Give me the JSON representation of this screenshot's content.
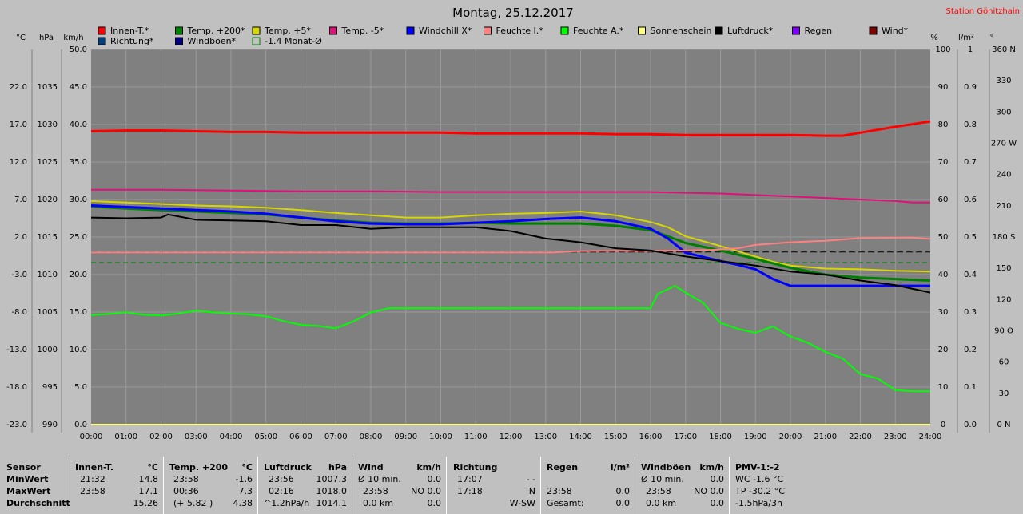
{
  "title": "Montag, 25.12.2017",
  "station": "Station Gönitzhain",
  "axes": {
    "celsius": {
      "unit": "°C",
      "ticks": [
        "22.0",
        "17.0",
        "12.0",
        "7.0",
        "2.0",
        "-3.0",
        "-8.0",
        "-13.0",
        "-18.0",
        "-23.0"
      ]
    },
    "hpa": {
      "unit": "hPa",
      "ticks": [
        "1035",
        "1030",
        "1025",
        "1020",
        "1015",
        "1010",
        "1005",
        "1000",
        "995",
        "990"
      ]
    },
    "kmh": {
      "unit": "km/h",
      "ticks": [
        "50.0",
        "45.0",
        "40.0",
        "35.0",
        "30.0",
        "25.0",
        "20.0",
        "15.0",
        "10.0",
        "5.0",
        "0.0"
      ]
    },
    "percent": {
      "unit": "%",
      "ticks": [
        "100",
        "90",
        "80",
        "70",
        "60",
        "50",
        "40",
        "30",
        "20",
        "10",
        "0"
      ]
    },
    "rain": {
      "unit": "l/m²",
      "ticks": [
        "1",
        "0.9",
        "0.8",
        "0.7",
        "0.6",
        "0.5",
        "0.4",
        "0.3",
        "0.2",
        "0.1",
        "0.0"
      ]
    },
    "deg": {
      "unit": "°",
      "ticks": [
        "360 N",
        "330",
        "300",
        "270 W",
        "240",
        "210",
        "180 S",
        "150",
        "120",
        "90 O",
        "60",
        "30",
        "0 N"
      ]
    },
    "time": [
      "00:00",
      "01:00",
      "02:00",
      "03:00",
      "04:00",
      "05:00",
      "06:00",
      "07:00",
      "08:00",
      "09:00",
      "10:00",
      "11:00",
      "12:00",
      "13:00",
      "14:00",
      "15:00",
      "16:00",
      "17:00",
      "18:00",
      "19:00",
      "20:00",
      "21:00",
      "22:00",
      "23:00",
      "24:00"
    ]
  },
  "legend": [
    {
      "label": "Innen-T.*",
      "color": "#ff0000"
    },
    {
      "label": "Temp. +200*",
      "color": "#008000"
    },
    {
      "label": "Temp. +5*",
      "color": "#d6d600"
    },
    {
      "label": "Temp. -5*",
      "color": "#e0107a"
    },
    {
      "label": "Windchill X*",
      "color": "#0000ff"
    },
    {
      "label": "Feuchte I.*",
      "color": "#ff8080"
    },
    {
      "label": "Feuchte A.*",
      "color": "#00ff00"
    },
    {
      "label": "Sonnenschein",
      "color": "#ffff80"
    },
    {
      "label": "Luftdruck*",
      "color": "#000000"
    },
    {
      "label": "Regen",
      "color": "#8000ff"
    },
    {
      "label": "Wind*",
      "color": "#800000"
    },
    {
      "label": "Richtung*",
      "color": "#004080"
    },
    {
      "label": "Windböen*",
      "color": "#000080"
    },
    {
      "label": "-1.4 Monat-Ø",
      "color": "#008000",
      "text_color": "#008000",
      "hollow": true
    }
  ],
  "chart_data": {
    "type": "line",
    "x_unit": "hour",
    "xlim": [
      0,
      24
    ],
    "ylabel": "°C",
    "ylim": [
      -23,
      27
    ],
    "series": [
      {
        "name": "Innen-T.*",
        "axis": "°C",
        "color": "#ff0000",
        "width": 3,
        "x": [
          0,
          1,
          2,
          3,
          4,
          5,
          6,
          7,
          8,
          9,
          10,
          11,
          12,
          13,
          14,
          15,
          16,
          17,
          18,
          19,
          20,
          21,
          21.5,
          22,
          23,
          24
        ],
        "y": [
          16.1,
          16.2,
          16.2,
          16.1,
          16.0,
          16.0,
          15.9,
          15.9,
          15.9,
          15.9,
          15.9,
          15.8,
          15.8,
          15.8,
          15.8,
          15.7,
          15.7,
          15.6,
          15.6,
          15.6,
          15.6,
          15.5,
          15.5,
          15.9,
          16.7,
          17.4
        ]
      },
      {
        "name": "Temp. -5*",
        "axis": "°C",
        "color": "#e0107a",
        "width": 2,
        "x": [
          0,
          2,
          4,
          6,
          8,
          10,
          12,
          14,
          16,
          18,
          19,
          20,
          21,
          22,
          23,
          23.5,
          24
        ],
        "y": [
          8.3,
          8.3,
          8.2,
          8.1,
          8.1,
          8.0,
          8.0,
          8.0,
          8.0,
          7.8,
          7.6,
          7.4,
          7.2,
          7.0,
          6.8,
          6.6,
          6.6
        ]
      },
      {
        "name": "Temp. +5*",
        "axis": "°C",
        "color": "#d6d600",
        "width": 2,
        "x": [
          0,
          1,
          2,
          3,
          4,
          5,
          6,
          7,
          8,
          9,
          10,
          11,
          12,
          13,
          14,
          15,
          16,
          16.5,
          17,
          18,
          19,
          19.5,
          20,
          21,
          22,
          23,
          24
        ],
        "y": [
          6.8,
          6.6,
          6.4,
          6.2,
          6.1,
          5.9,
          5.6,
          5.2,
          4.9,
          4.6,
          4.6,
          4.9,
          5.1,
          5.2,
          5.4,
          4.9,
          4.0,
          3.3,
          2.1,
          0.8,
          -0.6,
          -1.3,
          -1.8,
          -2.2,
          -2.3,
          -2.5,
          -2.6
        ]
      },
      {
        "name": "Temp. +200*",
        "axis": "°C",
        "color": "#008000",
        "width": 3,
        "x": [
          0,
          1,
          2,
          3,
          4,
          5,
          6,
          7,
          8,
          9,
          10,
          11,
          12,
          13,
          14,
          15,
          16,
          16.5,
          17,
          18,
          19,
          20,
          21,
          22,
          23,
          24
        ],
        "y": [
          6.1,
          5.8,
          5.6,
          5.4,
          5.2,
          5.0,
          4.6,
          4.2,
          3.9,
          3.8,
          3.8,
          3.9,
          3.8,
          3.8,
          3.8,
          3.5,
          2.9,
          2.1,
          1.2,
          0.2,
          -0.9,
          -2.1,
          -3.0,
          -3.4,
          -3.6,
          -3.8
        ]
      },
      {
        "name": "Windchill X*",
        "axis": "°C",
        "color": "#0000ff",
        "width": 3,
        "x": [
          0,
          1,
          2,
          3,
          4,
          5,
          6,
          7,
          8,
          9,
          10,
          11,
          12,
          13,
          14,
          15,
          16,
          16.5,
          17,
          18,
          18.5,
          19,
          19.5,
          20,
          21,
          22,
          23,
          24
        ],
        "y": [
          6.2,
          6.0,
          5.8,
          5.6,
          5.4,
          5.1,
          4.6,
          4.1,
          3.8,
          3.7,
          3.7,
          3.9,
          4.1,
          4.4,
          4.6,
          4.1,
          3.1,
          1.8,
          -0.1,
          -1.2,
          -1.7,
          -2.3,
          -3.6,
          -4.5,
          -4.5,
          -4.5,
          -4.5,
          -4.5
        ]
      },
      {
        "name": "Feuchte I.*",
        "axis": "%",
        "color": "#ff8080",
        "width": 2,
        "x": [
          0,
          2,
          4,
          6,
          8,
          10,
          12,
          13.2,
          13.8,
          14.5,
          15,
          16,
          17,
          17.8,
          18.5,
          19,
          20,
          21,
          22,
          23,
          23.5,
          24
        ],
        "y": [
          45.9,
          45.9,
          45.9,
          45.9,
          45.9,
          45.9,
          45.9,
          45.9,
          46.2,
          46.3,
          46.3,
          46.3,
          46.4,
          46.6,
          47.0,
          47.9,
          48.6,
          49.0,
          49.7,
          49.8,
          49.8,
          49.5
        ]
      },
      {
        "name": "Feuchte A.*",
        "axis": "%",
        "color": "#00ff00",
        "width": 2,
        "x": [
          0,
          0.5,
          1,
          1.5,
          2,
          2.5,
          3,
          3.5,
          4,
          4.5,
          5,
          5.5,
          6,
          6.5,
          7,
          7.5,
          8,
          8.5,
          9,
          10,
          11,
          12,
          13,
          14,
          15,
          16,
          16.2,
          16.7,
          17,
          17.5,
          18,
          18.5,
          19,
          19.5,
          20,
          20.5,
          21,
          21.5,
          22,
          22.5,
          23,
          23.5,
          24
        ],
        "y": [
          29.2,
          29.5,
          29.9,
          29.3,
          29.1,
          29.6,
          30.4,
          29.9,
          29.6,
          29.4,
          28.9,
          27.6,
          26.6,
          26.3,
          25.7,
          27.5,
          29.9,
          31.0,
          31.0,
          31.0,
          31.0,
          31.0,
          31.0,
          31.0,
          31.0,
          31.0,
          34.8,
          37.0,
          35.2,
          32.5,
          27.1,
          25.5,
          24.5,
          26.2,
          23.5,
          21.8,
          19.4,
          17.6,
          13.5,
          12.3,
          9.2,
          8.9,
          8.9
        ]
      },
      {
        "name": "Luftdruck*",
        "axis": "hPa",
        "color": "#000000",
        "width": 2,
        "x": [
          0,
          1,
          2,
          2.2,
          3,
          4,
          5,
          6,
          7,
          8,
          9,
          10,
          11,
          12,
          13,
          14,
          15,
          16,
          17,
          18,
          19,
          20,
          21,
          21.5,
          22,
          23,
          24
        ],
        "y": [
          1017.6,
          1017.5,
          1017.6,
          1018.0,
          1017.3,
          1017.2,
          1017.1,
          1016.6,
          1016.6,
          1016.1,
          1016.3,
          1016.3,
          1016.3,
          1015.8,
          1014.8,
          1014.3,
          1013.5,
          1013.2,
          1012.4,
          1011.8,
          1011.2,
          1010.4,
          1010.0,
          1009.6,
          1009.2,
          1008.6,
          1007.6
        ]
      },
      {
        "name": "Sonnenschein",
        "axis": "%",
        "color": "#ffff80",
        "width": 2,
        "x": [
          0,
          24
        ],
        "y": [
          0,
          0
        ]
      }
    ],
    "reference_lines": [
      {
        "axis": "°C",
        "y": -1.4,
        "color": "#008000",
        "dash": "6,4"
      },
      {
        "axis": "°C",
        "y": 0,
        "color": "#000000",
        "dash": "8,4"
      }
    ]
  },
  "stats": {
    "sensor": {
      "title": "Sensor",
      "rows": [
        "MinWert",
        "MaxWert",
        "Durchschnitt"
      ]
    },
    "innen": {
      "title": "Innen-T.",
      "unit": "°C",
      "rows": [
        [
          "21:32",
          "14.8"
        ],
        [
          "23:58",
          "17.1"
        ],
        [
          "",
          "15.26"
        ]
      ]
    },
    "temp": {
      "title": "Temp. +200",
      "unit": "°C",
      "rows": [
        [
          "23:58",
          "-1.6"
        ],
        [
          "00:36",
          "7.3"
        ],
        [
          "(+ 5.82 )",
          "4.38"
        ]
      ]
    },
    "luft": {
      "title": "Luftdruck",
      "unit": "hPa",
      "rows": [
        [
          "23:56",
          "1007.3"
        ],
        [
          "02:16",
          "1018.0"
        ],
        [
          "^1.2hPa/h",
          "1014.1"
        ]
      ]
    },
    "wind": {
      "title": "Wind",
      "unit": "km/h",
      "rows": [
        [
          "Ø 10 min.",
          "0.0"
        ],
        [
          "23:58",
          "NO 0.0"
        ],
        [
          "0.0 km",
          "0.0"
        ]
      ]
    },
    "richtung": {
      "title": "Richtung",
      "unit": "",
      "rows": [
        [
          "17:07",
          "- -"
        ],
        [
          "17:18",
          "N"
        ],
        [
          "",
          "W-SW"
        ]
      ]
    },
    "regen": {
      "title": "Regen",
      "unit": "l/m²",
      "rows": [
        [
          "",
          ""
        ],
        [
          "23:58",
          "0.0"
        ],
        [
          "Gesamt:",
          "0.0"
        ]
      ]
    },
    "boeen": {
      "title": "Windböen",
      "unit": "km/h",
      "rows": [
        [
          "Ø 10 min.",
          "0.0"
        ],
        [
          "23:58",
          "NO 0.0"
        ],
        [
          "0.0 km",
          "0.0"
        ]
      ]
    },
    "pmv": {
      "title": "PMV-1:-2",
      "rows": [
        "WC -1.6 °C",
        "TP -30.2 °C",
        "-1.5hPa/3h"
      ]
    }
  }
}
